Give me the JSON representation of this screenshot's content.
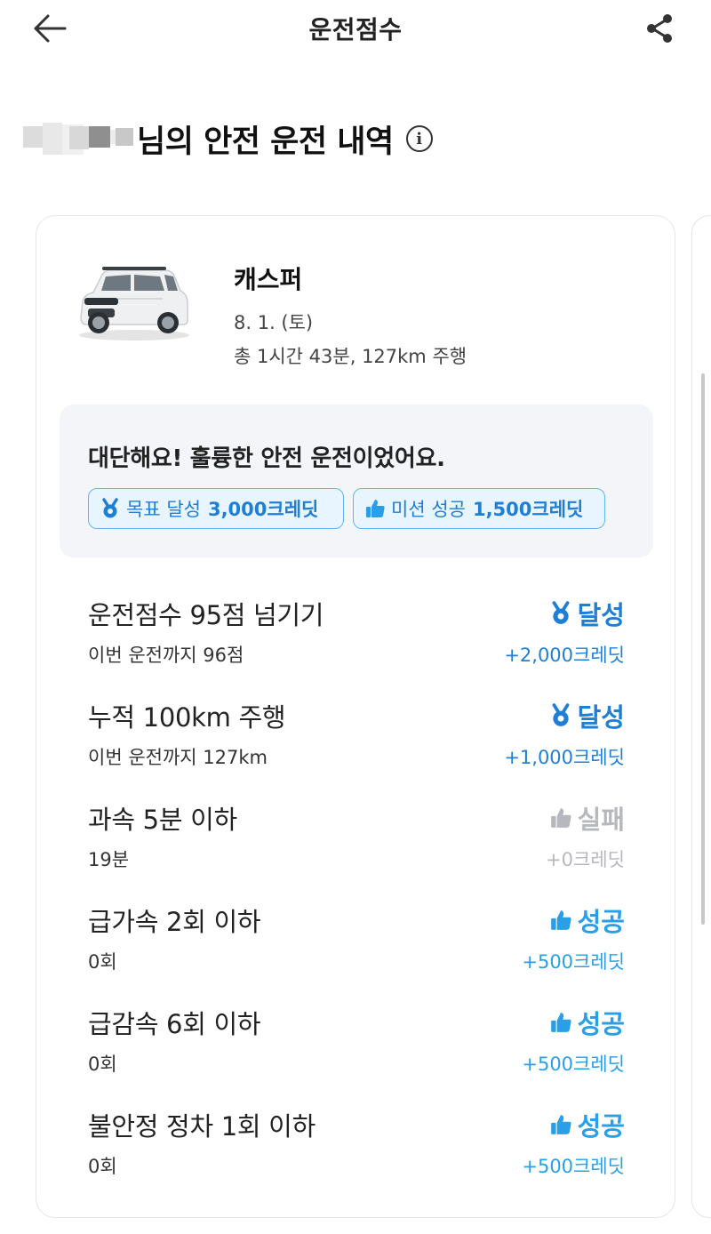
{
  "header": {
    "title": "운전점수"
  },
  "heading": {
    "text": "님의 안전 운전 내역",
    "info_icon_glyph": "i"
  },
  "car": {
    "name": "캐스퍼",
    "date": "8. 1. (토)",
    "trip": "총 1시간 43분, 127km 주행",
    "color": "#e9ebee"
  },
  "praise": {
    "message": "대단해요! 훌륭한 안전 운전이었어요.",
    "goal_badge": {
      "label": "목표 달성",
      "credit": "3,000크레딧",
      "icon": "medal-icon"
    },
    "mission_badge": {
      "label": "미션 성공",
      "credit": "1,500크레딧",
      "icon": "thumbs-up-icon"
    }
  },
  "missions": [
    {
      "title": "운전점수 95점 넘기기",
      "detail": "이번 운전까지 96점",
      "status": "달성",
      "credit": "+2,000크레딧",
      "icon": "medal-icon",
      "state": "achieved"
    },
    {
      "title": "누적 100km 주행",
      "detail": "이번 운전까지 127km",
      "status": "달성",
      "credit": "+1,000크레딧",
      "icon": "medal-icon",
      "state": "achieved"
    },
    {
      "title": "과속 5분 이하",
      "detail": "19분",
      "status": "실패",
      "credit": "+0크레딧",
      "icon": "thumbs-up-icon",
      "state": "failed"
    },
    {
      "title": "급가속 2회 이하",
      "detail": "0회",
      "status": "성공",
      "credit": "+500크레딧",
      "icon": "thumbs-up-icon",
      "state": "success"
    },
    {
      "title": "급감속 6회 이하",
      "detail": "0회",
      "status": "성공",
      "credit": "+500크레딧",
      "icon": "thumbs-up-icon",
      "state": "success"
    },
    {
      "title": "불안정 정차 1회 이하",
      "detail": "0회",
      "status": "성공",
      "credit": "+500크레딧",
      "icon": "thumbs-up-icon",
      "state": "success"
    }
  ],
  "colors": {
    "accent_blue": "#1f7fd6",
    "accent_sky": "#2a9fe8",
    "failed_gray": "#b6b8bd",
    "badge_bg": "#e8f4fe",
    "praise_bg": "#f3f5f9"
  }
}
